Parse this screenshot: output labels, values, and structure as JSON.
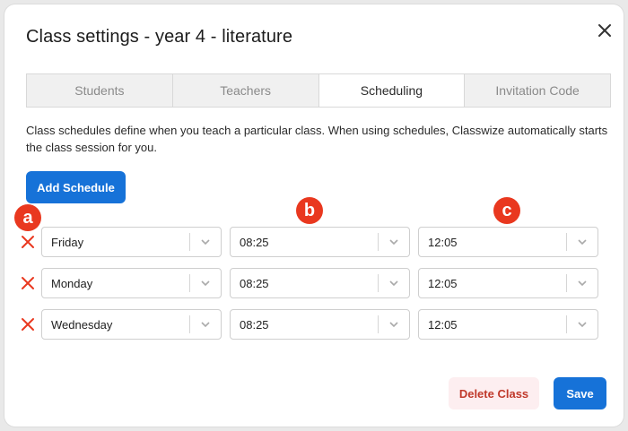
{
  "dialog": {
    "title": "Class settings - year 4 - literature",
    "close_icon": "close-icon"
  },
  "tabs": [
    {
      "label": "Students",
      "active": false
    },
    {
      "label": "Teachers",
      "active": false
    },
    {
      "label": "Scheduling",
      "active": true
    },
    {
      "label": "Invitation Code",
      "active": false
    }
  ],
  "description": "Class schedules define when you teach a particular class. When using schedules, Classwize automatically starts the class session for you.",
  "add_schedule_label": "Add Schedule",
  "markers": {
    "a": "a",
    "b": "b",
    "c": "c"
  },
  "schedules": [
    {
      "day": "Friday",
      "start": "08:25",
      "end": "12:05"
    },
    {
      "day": "Monday",
      "start": "08:25",
      "end": "12:05"
    },
    {
      "day": "Wednesday",
      "start": "08:25",
      "end": "12:05"
    }
  ],
  "footer": {
    "delete_label": "Delete Class",
    "save_label": "Save"
  },
  "colors": {
    "primary": "#1672d8",
    "danger": "#e9381f",
    "delete_text": "#c0392b",
    "delete_bg": "#fdeef0"
  }
}
